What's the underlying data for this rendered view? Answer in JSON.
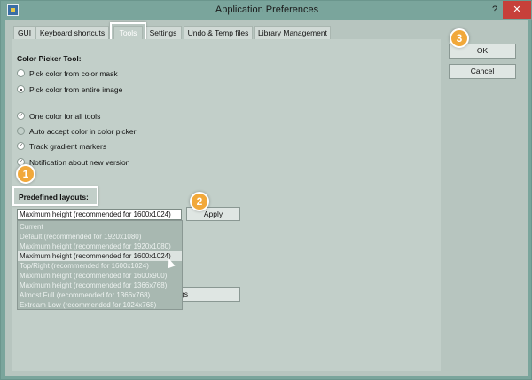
{
  "window": {
    "title": "Application Preferences",
    "help": "?",
    "close": "✕"
  },
  "tabs": [
    {
      "label": "GUI"
    },
    {
      "label": "Keyboard shortcuts"
    },
    {
      "label": "Tools"
    },
    {
      "label": "Settings"
    },
    {
      "label": "Undo & Temp files"
    },
    {
      "label": "Library Management"
    }
  ],
  "color_picker": {
    "title": "Color Picker Tool:",
    "options": [
      "Pick color from color mask",
      "Pick color from entire image"
    ],
    "selected": 1
  },
  "checkboxes": [
    {
      "label": "One color for all tools",
      "checked": true
    },
    {
      "label": "Auto accept color in color picker",
      "checked": false
    },
    {
      "label": "Track gradient markers",
      "checked": true
    },
    {
      "label": "Notification about new version",
      "checked": true
    }
  ],
  "layouts": {
    "title": "Predefined layouts:",
    "selected_value": "Maximum height (recommended for 1600x1024)",
    "apply_label": "Apply",
    "options": [
      "Current",
      "Default (recommended for 1920x1080)",
      "Maximum height (recommended for 1920x1080)",
      "Maximum height (recommended for 1600x1024)",
      "Top/Right (recommended for 1600x1024)",
      "Maximum height (recommended for 1600x900)",
      "Maximum height (recommended for 1366x768)",
      "Almost Full (recommended for 1366x768)",
      "Extream Low (recommended for 1024x768)"
    ],
    "highlighted_index": 3,
    "hidden_button_fragment": "gs"
  },
  "dialog_buttons": {
    "ok": "OK",
    "cancel": "Cancel"
  },
  "badges": [
    "1",
    "2",
    "3"
  ],
  "colors": {
    "window_frame": "#7aa59c",
    "close": "#c7403a",
    "badge": "#f1a83a"
  }
}
